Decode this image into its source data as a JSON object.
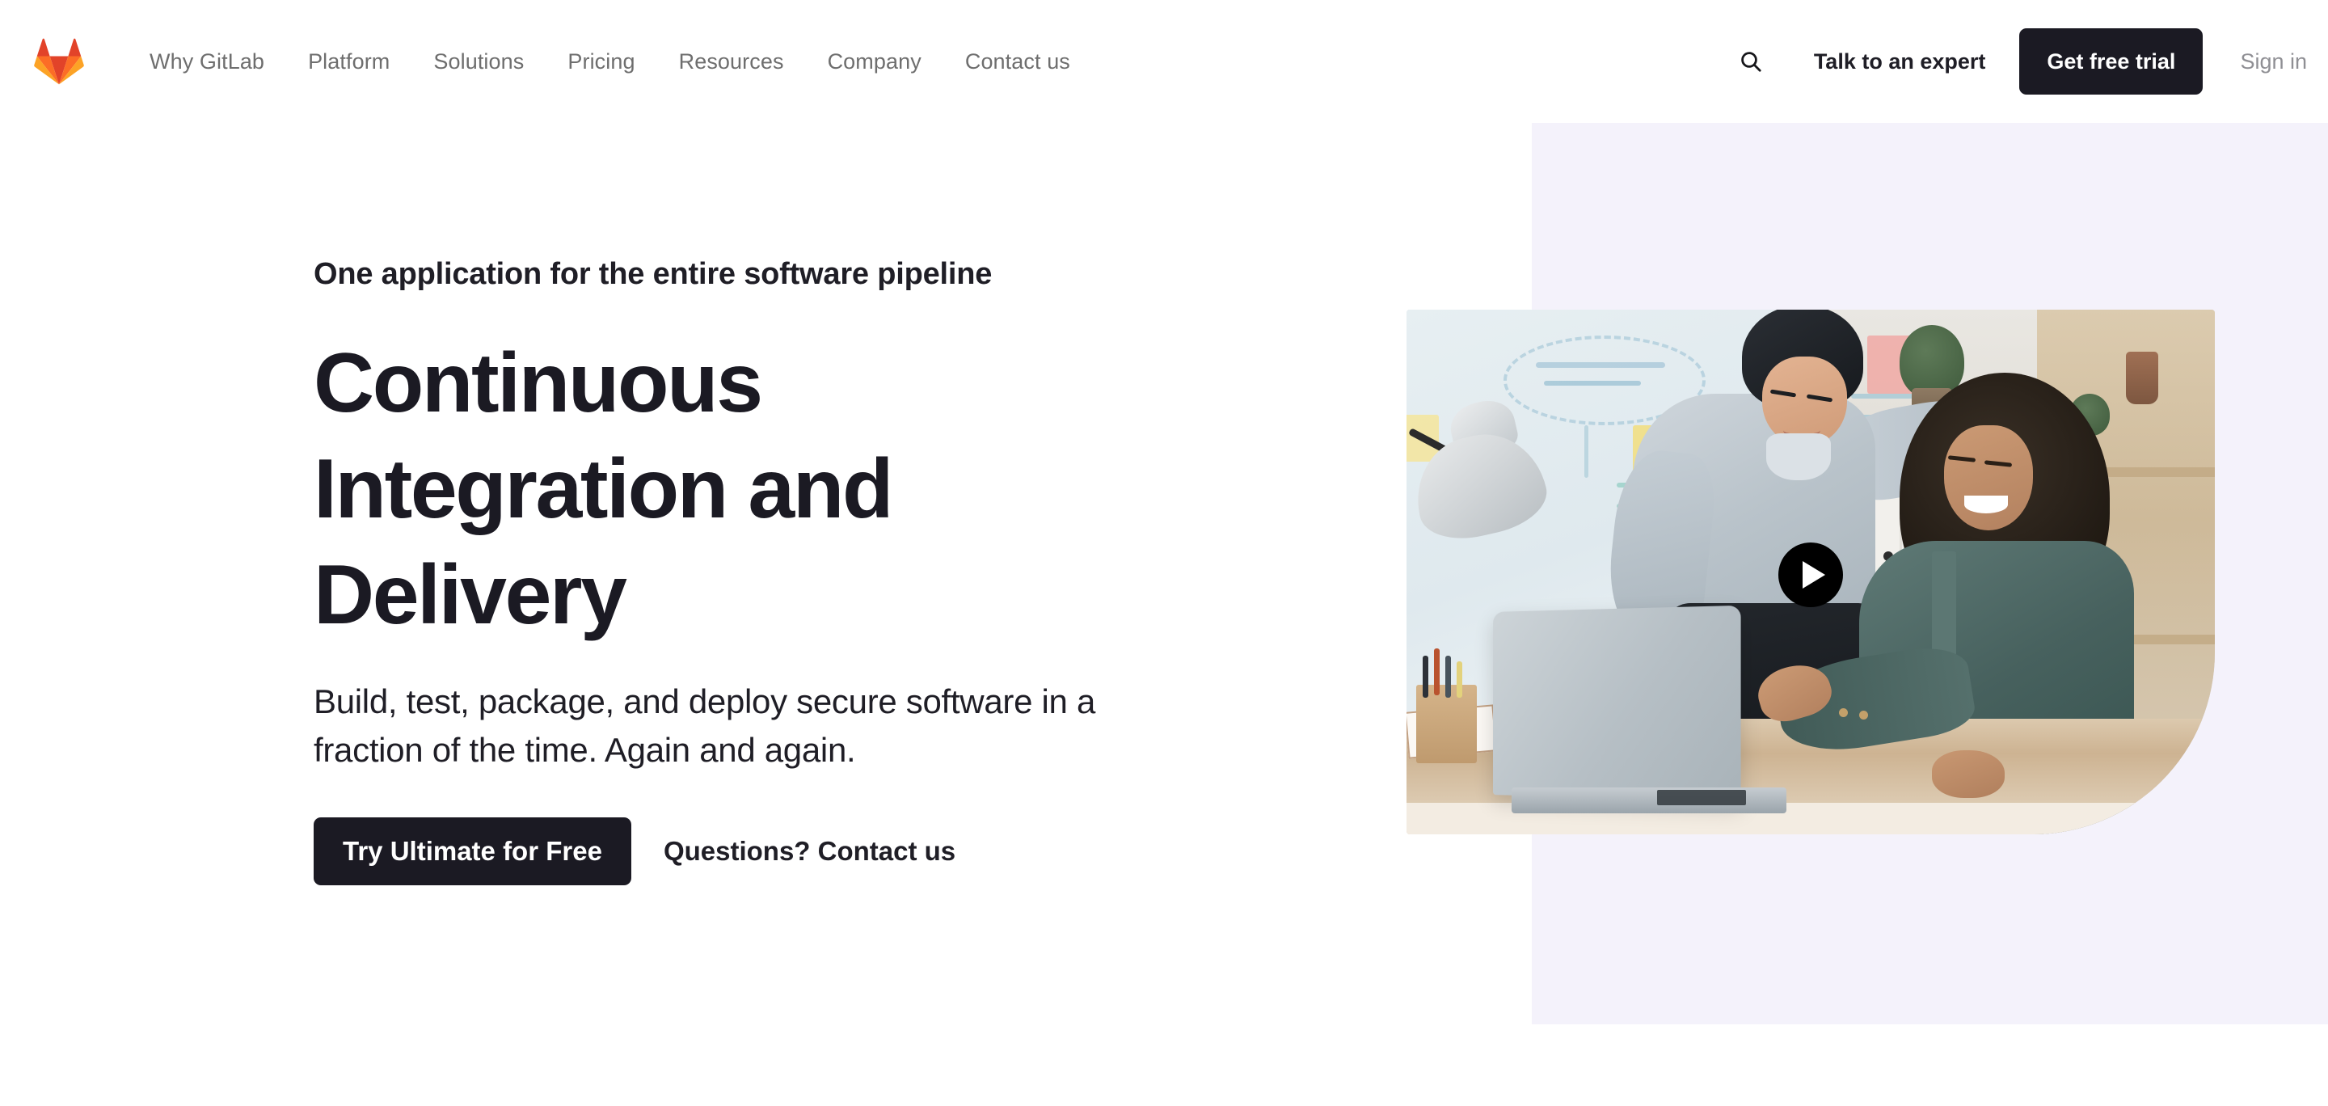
{
  "nav": {
    "logo_icon": "gitlab-tanuki-logo",
    "links": [
      {
        "label": "Why GitLab"
      },
      {
        "label": "Platform"
      },
      {
        "label": "Solutions"
      },
      {
        "label": "Pricing"
      },
      {
        "label": "Resources"
      },
      {
        "label": "Company"
      },
      {
        "label": "Contact us"
      }
    ],
    "search_icon": "search-icon",
    "talk_to_expert": "Talk to an expert",
    "get_free_trial": "Get free trial",
    "sign_in": "Sign in"
  },
  "hero": {
    "eyebrow": "One application for the entire software pipeline",
    "headline_line1": "Continuous",
    "headline_line2": "Integration and",
    "headline_line3": "Delivery",
    "subhead_line1": "Build, test, package, and deploy secure software in",
    "subhead_line2": "a fraction of the time. Again and again.",
    "cta_primary": "Try Ultimate for Free",
    "cta_secondary": "Questions? Contact us"
  },
  "media": {
    "play_icon": "play-icon",
    "description": "Two colleagues smiling at a laptop in a bright office"
  },
  "colors": {
    "brand_orange": "#e24329",
    "brand_orange_light": "#fc6d26",
    "brand_orange_lighter": "#fca326",
    "dark": "#1b1a23",
    "panel_lavender": "#f4f2fb",
    "nav_link_gray": "#6e6e6e",
    "signin_gray": "#8f8f94"
  }
}
